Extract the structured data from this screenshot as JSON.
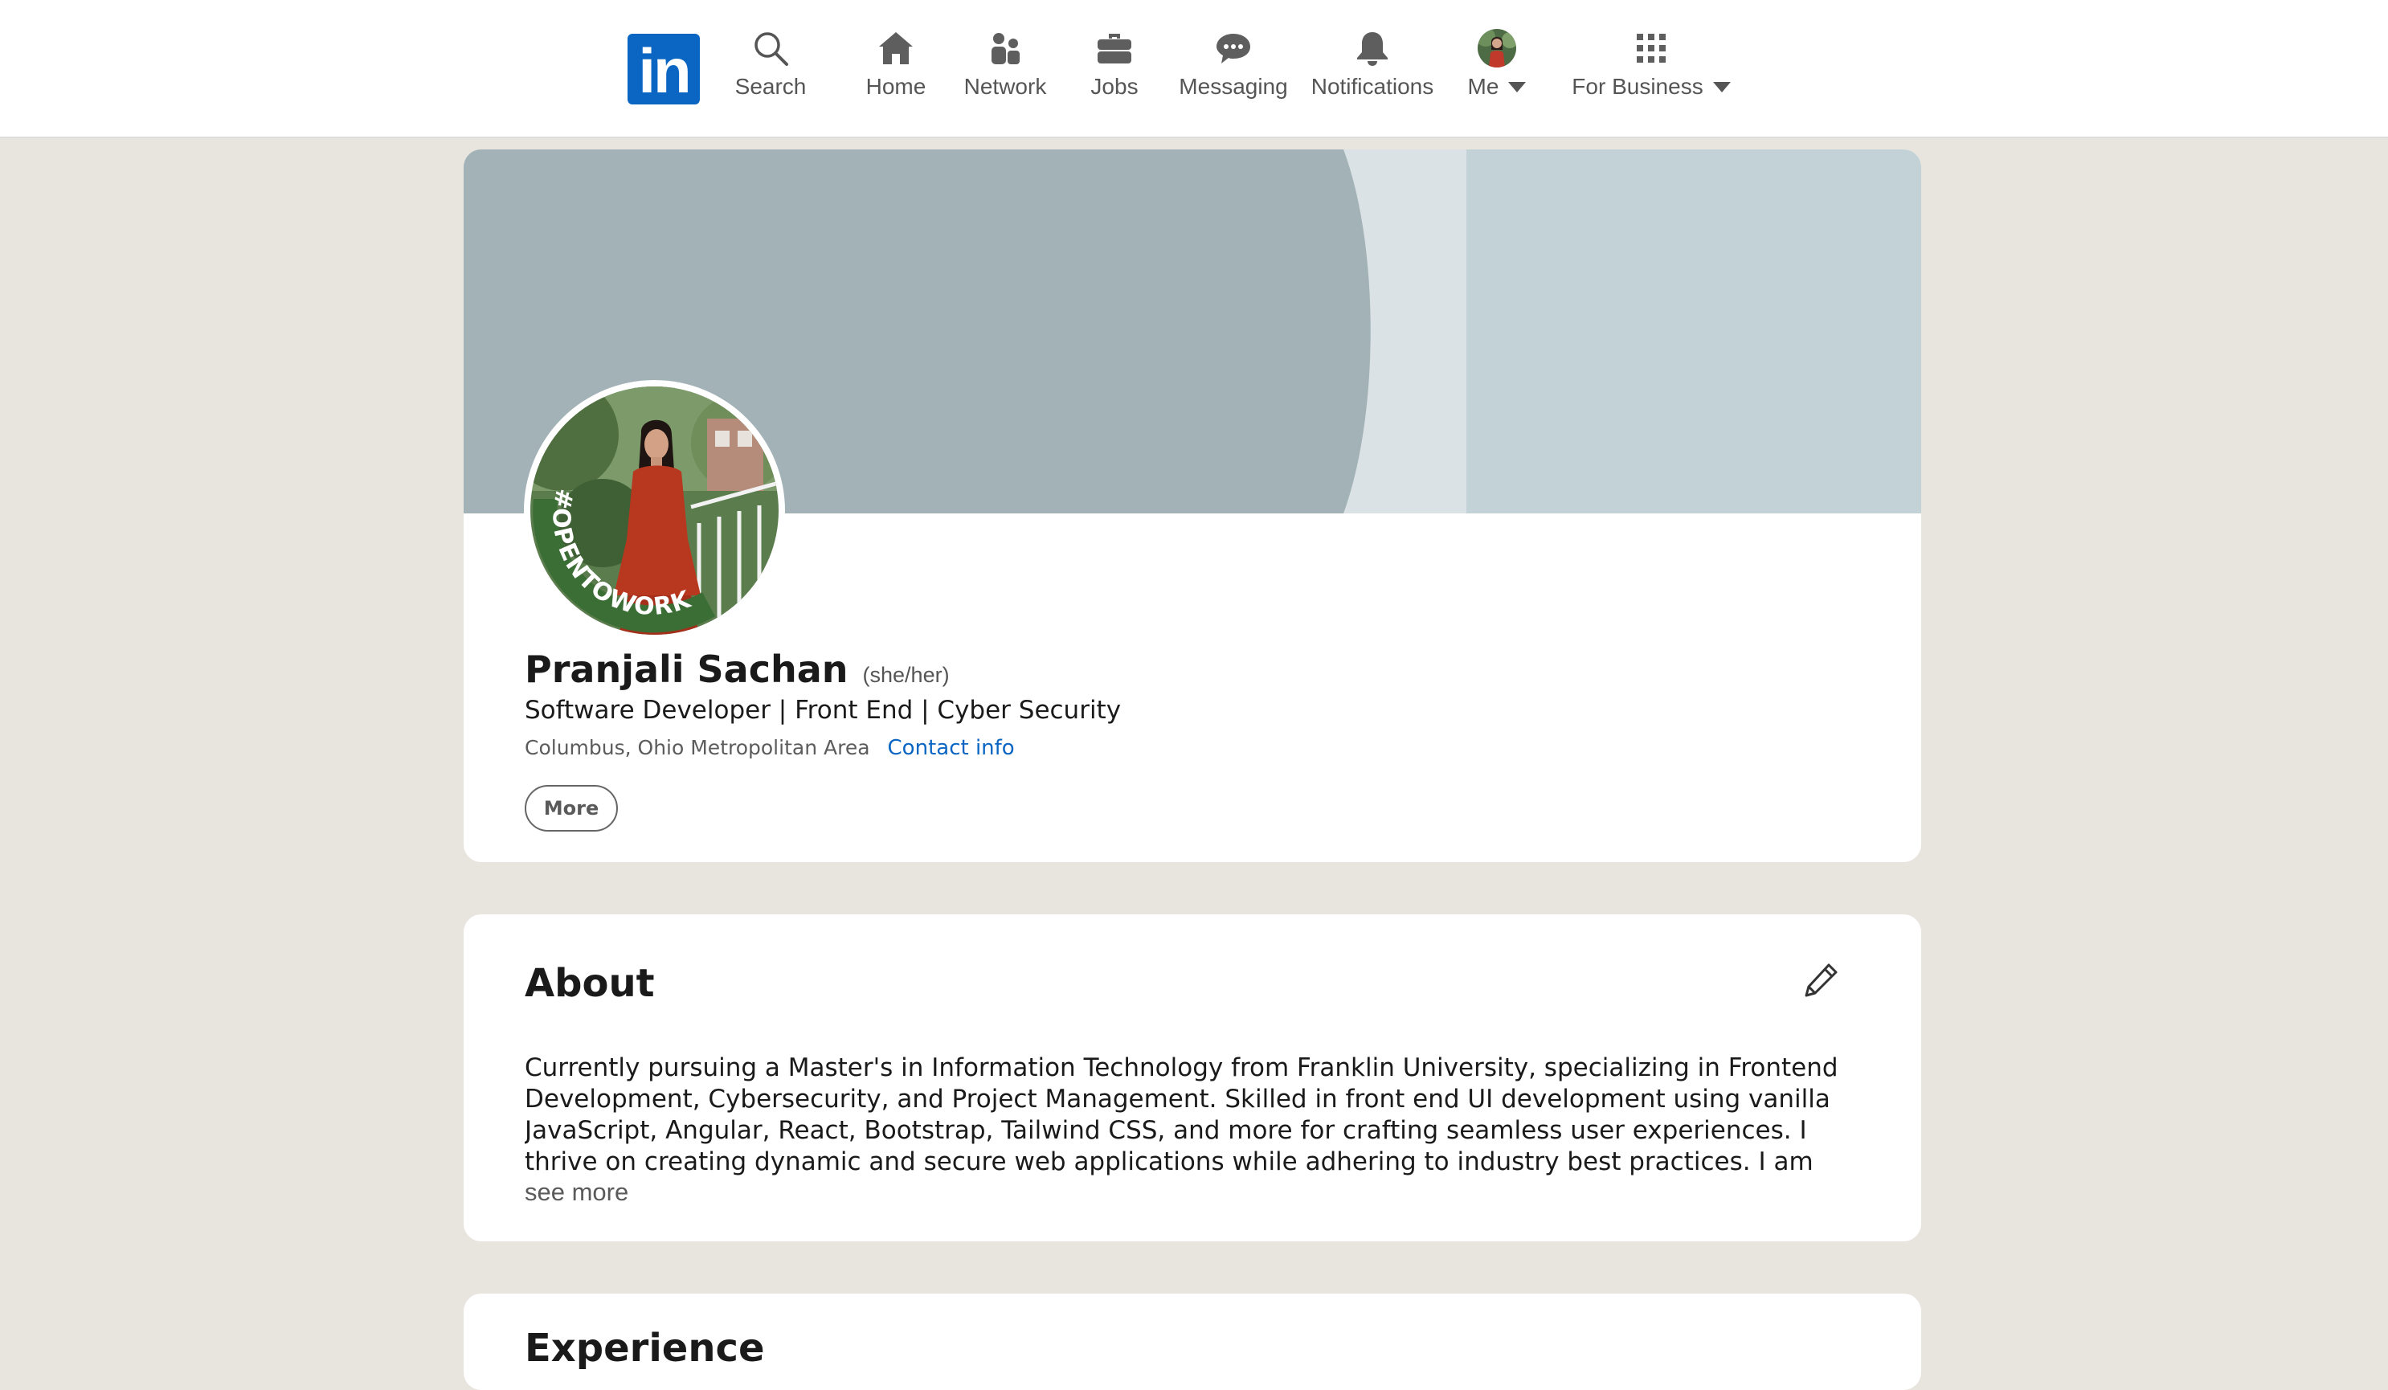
{
  "nav": {
    "logo_text": "in",
    "items": [
      {
        "label": "Search",
        "icon": "search-icon"
      },
      {
        "label": "Home",
        "icon": "home-icon"
      },
      {
        "label": "Network",
        "icon": "network-icon"
      },
      {
        "label": "Jobs",
        "icon": "briefcase-icon"
      },
      {
        "label": "Messaging",
        "icon": "messaging-icon"
      },
      {
        "label": "Notifications",
        "icon": "bell-icon"
      },
      {
        "label": "Me",
        "icon": "avatar"
      },
      {
        "label": "For Business",
        "icon": "grid-icon"
      }
    ]
  },
  "profile": {
    "name": "Pranjali Sachan",
    "pronouns": "(she/her)",
    "headline": "Software Developer | Front End | Cyber Security",
    "location": "Columbus, Ohio Metropolitan Area",
    "contact_label": "Contact info",
    "more_label": "More",
    "open_to_work_badge": "#OPENTOWORK"
  },
  "about": {
    "title": "About",
    "text": "Currently pursuing a Master's in Information Technology from Franklin University, specializing in Frontend Development, Cybersecurity, and Project Management. Skilled in front end UI development using vanilla JavaScript, Angular, React, Bootstrap, Tailwind CSS, and more for crafting seamless user experiences. I thrive on creating dynamic and secure web applications while adhering to industry best practices. I am committed to safeguarding…",
    "see_more": "see more"
  },
  "next_section": {
    "title": "Experience"
  },
  "colors": {
    "brand": "#0a66c2",
    "page_bg": "#e8e5df",
    "banner_dark": "#a2b2b6",
    "banner_light": "#dae2e5",
    "banner_right": "#c2d2d7",
    "open_to_work_green": "#3b6e35"
  }
}
